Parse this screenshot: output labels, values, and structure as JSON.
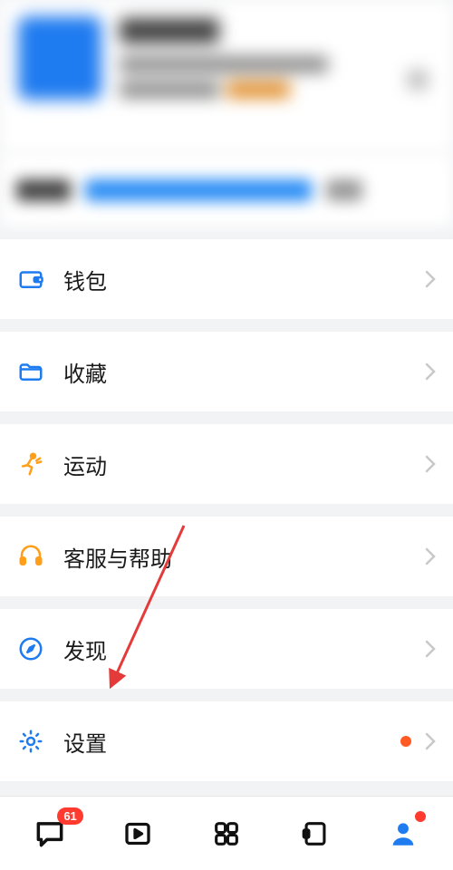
{
  "colors": {
    "accent_blue": "#1f7bf0",
    "accent_orange": "#ff9e18",
    "chevron": "#c8c8c8",
    "badge_red": "#ff3b30",
    "dot_orange": "#ff5a23",
    "bg": "#f2f3f5"
  },
  "profile": {
    "redacted": true
  },
  "menu": [
    {
      "id": "wallet",
      "icon": "wallet-icon",
      "label": "钱包",
      "icon_color": "#1f7bf0",
      "has_dot": false
    },
    {
      "id": "fav",
      "icon": "folder-icon",
      "label": "收藏",
      "icon_color": "#1f7bf0",
      "has_dot": false
    },
    {
      "id": "sport",
      "icon": "sport-icon",
      "label": "运动",
      "icon_color": "#ff9e18",
      "has_dot": false
    },
    {
      "id": "help",
      "icon": "headset-icon",
      "label": "客服与帮助",
      "icon_color": "#ff9e18",
      "has_dot": false
    },
    {
      "id": "discover",
      "icon": "compass-icon",
      "label": "发现",
      "icon_color": "#1f7bf0",
      "has_dot": false
    },
    {
      "id": "settings",
      "icon": "gear-icon",
      "label": "设置",
      "icon_color": "#1f7bf0",
      "has_dot": true
    }
  ],
  "annotation": {
    "arrow_points_to": "settings"
  },
  "tabbar": {
    "items": [
      {
        "id": "chat",
        "icon": "chat-icon",
        "badge_count": 61,
        "active": false
      },
      {
        "id": "video",
        "icon": "video-icon",
        "active": false
      },
      {
        "id": "apps",
        "icon": "grid-icon",
        "active": false
      },
      {
        "id": "discover",
        "icon": "portal-icon",
        "active": false
      },
      {
        "id": "me",
        "icon": "person-icon",
        "badge_dot": true,
        "active": true
      }
    ]
  }
}
